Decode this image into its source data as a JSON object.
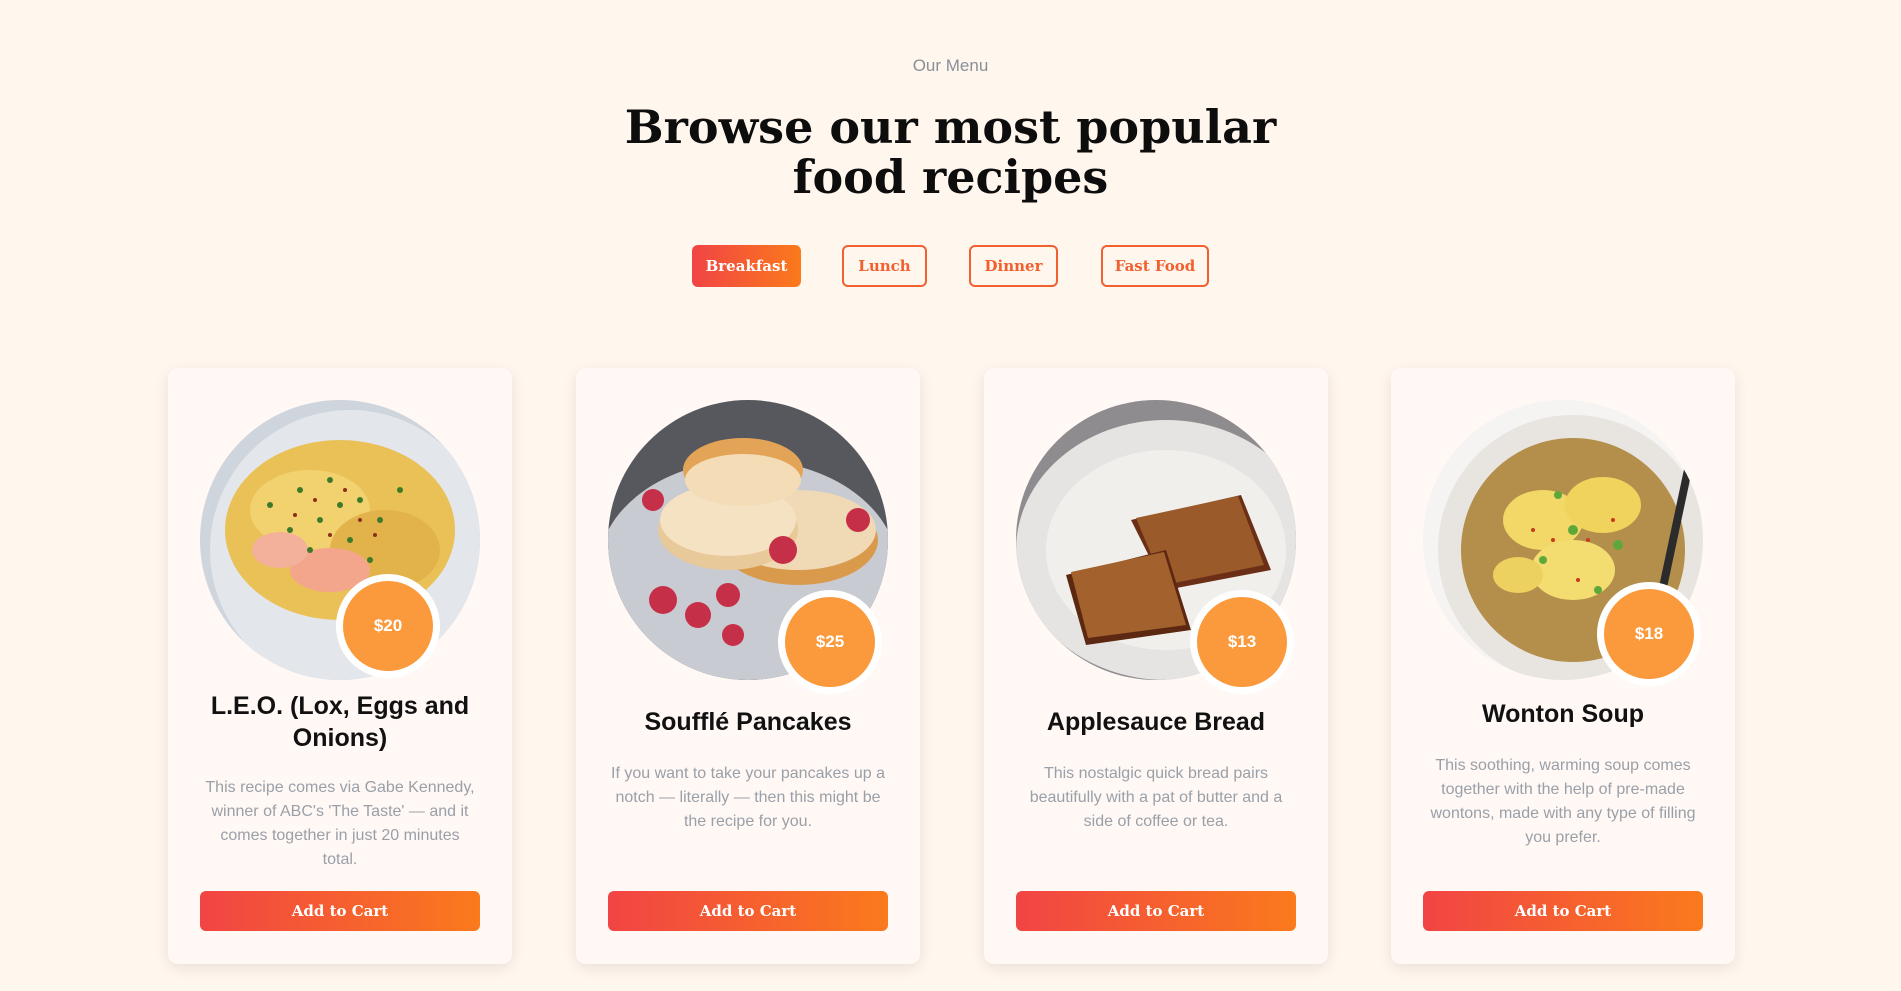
{
  "section": {
    "eyebrow": "Our Menu",
    "heading_line1": "Browse our most popular",
    "heading_line2": "food recipes"
  },
  "tabs": [
    {
      "label": "Breakfast",
      "active": true
    },
    {
      "label": "Lunch",
      "active": false
    },
    {
      "label": "Dinner",
      "active": false
    },
    {
      "label": "Fast Food",
      "active": false
    }
  ],
  "colors": {
    "background": "#fff6ee",
    "accent": "#f1602e",
    "gradient_start": "#f14444",
    "gradient_end": "#fb7a1c",
    "price_badge": "#fb9a3c"
  },
  "cards": [
    {
      "image": "scrambled-eggs-lox-photo",
      "price": "$20",
      "title_line1": "L.E.O. (Lox, Eggs and",
      "title_line2": "Onions)",
      "description": "This recipe comes via Gabe Kennedy, winner of ABC's 'The Taste' — and it comes together in just 20 minutes total.",
      "button": "Add to Cart"
    },
    {
      "image": "souffle-pancakes-photo",
      "price": "$25",
      "title_line1": "Soufflé Pancakes",
      "title_line2": "",
      "description": "If you want to take your pancakes up a notch — literally — then this might be the recipe for you.",
      "button": "Add to Cart"
    },
    {
      "image": "applesauce-bread-photo",
      "price": "$13",
      "title_line1": "Applesauce Bread",
      "title_line2": "",
      "description": "This nostalgic quick bread pairs beautifully with a pat of butter and a side of coffee or tea.",
      "button": "Add to Cart"
    },
    {
      "image": "wonton-soup-photo",
      "price": "$18",
      "title_line1": "Wonton Soup",
      "title_line2": "",
      "description": "This soothing, warming soup comes together with the help of pre-made wontons, made with any type of filling you prefer.",
      "button": "Add to Cart"
    }
  ]
}
